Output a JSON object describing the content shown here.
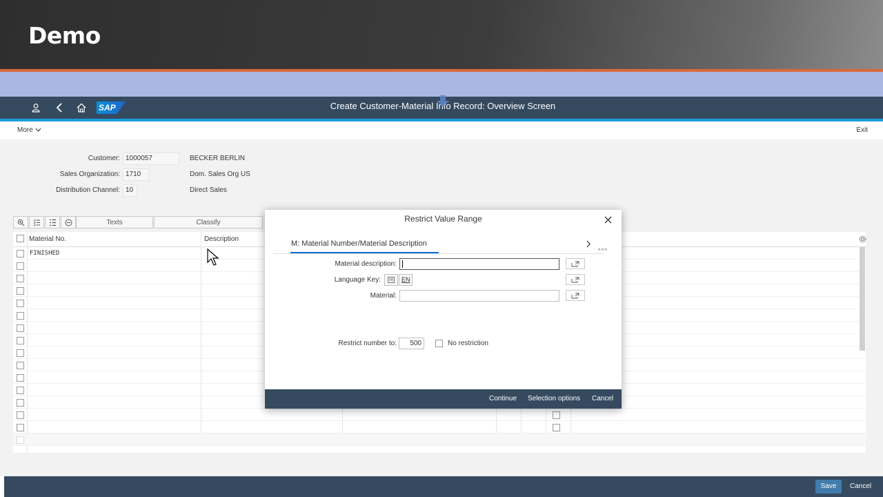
{
  "slide": {
    "title": "Demo"
  },
  "shell": {
    "title": "Create Customer-Material Info Record: Overview Screen",
    "logo": "SAP"
  },
  "toolbar": {
    "more": "More",
    "exit": "Exit"
  },
  "header": {
    "customer_label": "Customer:",
    "customer_value": "1000057",
    "customer_desc": "BECKER BERLIN",
    "salesorg_label": "Sales Organization:",
    "salesorg_value": "1710",
    "salesorg_desc": "Dom. Sales Org US",
    "distchan_label": "Distribution Channel:",
    "distchan_value": "10",
    "distchan_desc": "Direct Sales"
  },
  "table_toolbar": {
    "texts": "Texts",
    "classify": "Classify"
  },
  "grid": {
    "col_material": "Material No.",
    "col_description": "Description",
    "rows": [
      {
        "material": "FINISHED"
      }
    ]
  },
  "dialog": {
    "title": "Restrict Value Range",
    "tab": "M: Material Number/Material Description",
    "mat_desc_label": "Material description:",
    "lang_label": "Language Key:",
    "lang_value": "EN",
    "material_label": "Material:",
    "restrict_label": "Restrict number to:",
    "restrict_value": "500",
    "no_restriction": "No restriction",
    "continue": "Continue",
    "selection_options": "Selection options",
    "cancel": "Cancel"
  },
  "footer": {
    "save": "Save",
    "cancel": "Cancel"
  },
  "colors": {
    "shell": "#354a5f",
    "accent": "#1a9fd9",
    "orange": "#d8693a",
    "save": "#427cac"
  }
}
